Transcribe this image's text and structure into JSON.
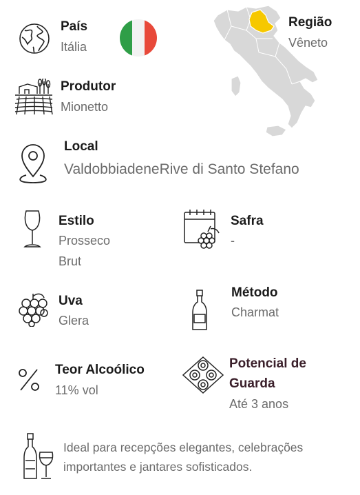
{
  "pais": {
    "label": "País",
    "value": "Itália",
    "icon": "globe-icon",
    "flag_colors": [
      "#2f9e47",
      "#f2f2f2",
      "#e8493a"
    ]
  },
  "regiao": {
    "label": "Região",
    "value": "Vêneto",
    "icon": "italy-map-icon",
    "highlight_color": "#f6c800",
    "map_color": "#d8d8d8"
  },
  "produtor": {
    "label": "Produtor",
    "value": "Mionetto",
    "icon": "vineyard-icon"
  },
  "local": {
    "label": "Local",
    "value": "ValdobbiadeneRive di Santo Stefano",
    "icon": "location-pin-icon"
  },
  "estilo": {
    "label": "Estilo",
    "value_line1": "Prosseco",
    "value_line2": "Brut",
    "icon": "wine-glass-icon"
  },
  "safra": {
    "label": "Safra",
    "value": "-",
    "icon": "calendar-grapes-icon"
  },
  "uva": {
    "label": "Uva",
    "value": "Glera",
    "icon": "grapes-icon"
  },
  "metodo": {
    "label": "Método",
    "value": "Charmat",
    "icon": "bottle-icon"
  },
  "teor": {
    "label": "Teor Alcoólico",
    "value": "11% vol",
    "icon": "percent-icon"
  },
  "guarda": {
    "label_line1": "Potencial de",
    "label_line2": "Guarda",
    "value": "Até 3 anos",
    "icon": "wine-rack-icon",
    "label_color": "#3a1f2a"
  },
  "harmonizacao": {
    "line1": "Ideal para recepções elegantes, celebrações",
    "line2": "importantes e jantares sofisticados.",
    "icon": "bottle-glass-icon"
  }
}
